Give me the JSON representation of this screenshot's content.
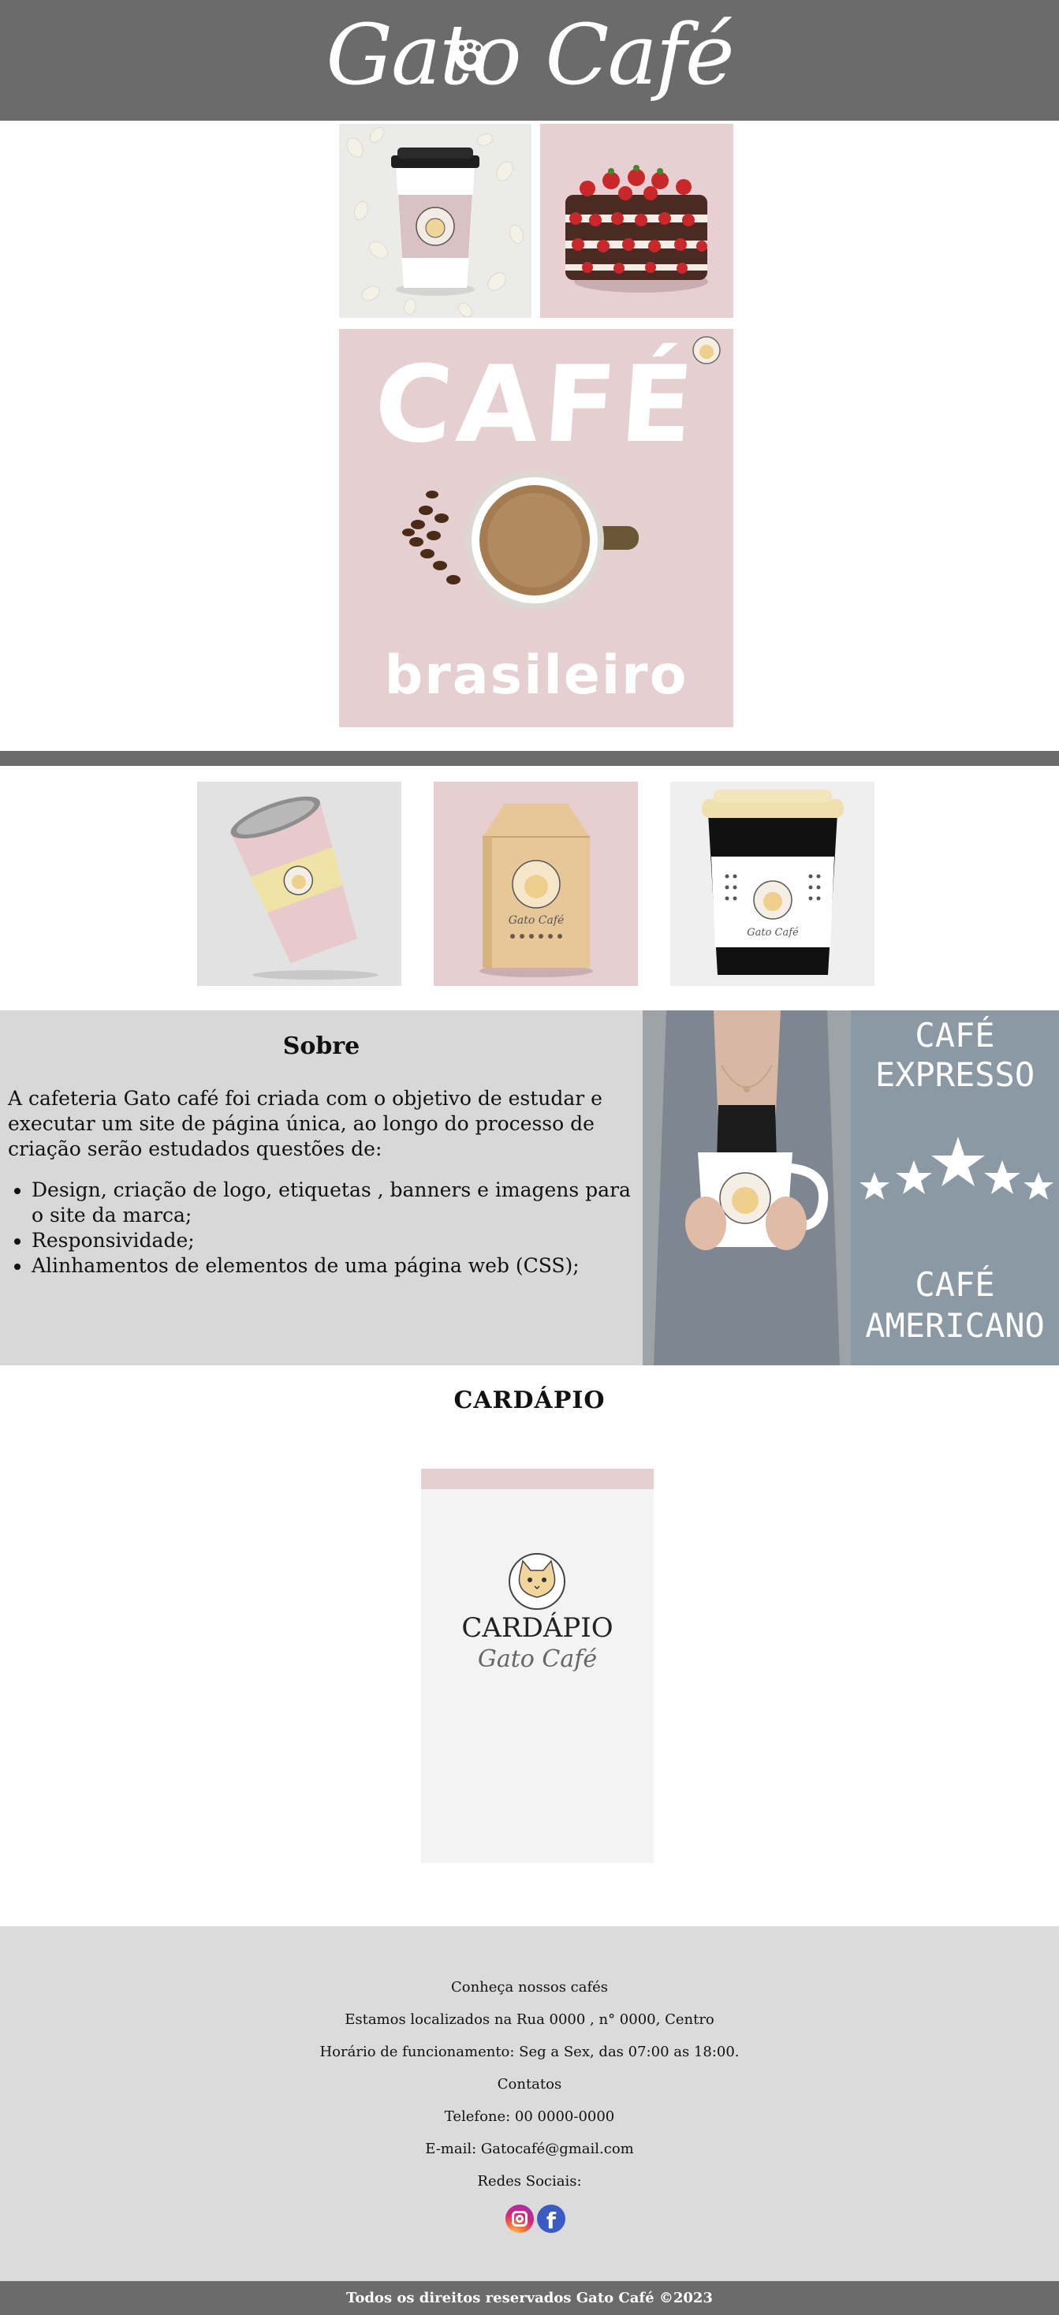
{
  "header": {
    "logo_text": "Gato Café",
    "logo_icon": "paw-icon"
  },
  "gallery": {
    "images": [
      "cup-with-petals-photo",
      "strawberry-cake-photo"
    ]
  },
  "banner": {
    "title": "CAFÉ",
    "subtitle": "brasileiro"
  },
  "products": {
    "images": [
      "pink-paper-cup-photo",
      "kraft-coffee-bag-photo",
      "black-white-takeaway-cup-photo"
    ]
  },
  "sobre": {
    "title": "Sobre",
    "text": "A cafeteria Gato café foi criada com o objetivo de estudar e executar um site de página única, ao longo do processo de criação serão estudados questões de:",
    "items": [
      "Design, criação de logo, etiquetas , banners e imagens para o site da marca;",
      "Responsividade;",
      "Alinhamentos de elementos de uma página web (CSS);"
    ]
  },
  "side_banner": {
    "top_line1": "CAFÉ",
    "top_line2": "EXPRESSO",
    "bottom_line1": "CAFÉ",
    "bottom_line2": "AMERICANO",
    "stars": 5
  },
  "cardapio": {
    "title": "CARDÁPIO",
    "card_title": "CARDÁPIO",
    "card_subtitle": "Gato Café"
  },
  "footer": {
    "lines": [
      "Conheça nossos cafés",
      "Estamos localizados na Rua 0000 , n° 0000, Centro",
      "Horário de funcionamento: Seg a Sex, das 07:00 as 18:00.",
      "Contatos",
      "Telefone: 00 0000-0000",
      "E-mail: Gatocafé@gmail.com",
      "Redes Sociais:"
    ],
    "social": [
      "instagram-icon",
      "facebook-icon"
    ],
    "facebook_glyph": "f"
  },
  "copyright": "Todos os direitos reservados Gato Café ©2023",
  "colors": {
    "header_gray": "#6b6b6b",
    "pink": "#e6cfd1",
    "section_gray": "#d8d8d8",
    "slate": "#8b99a4"
  }
}
